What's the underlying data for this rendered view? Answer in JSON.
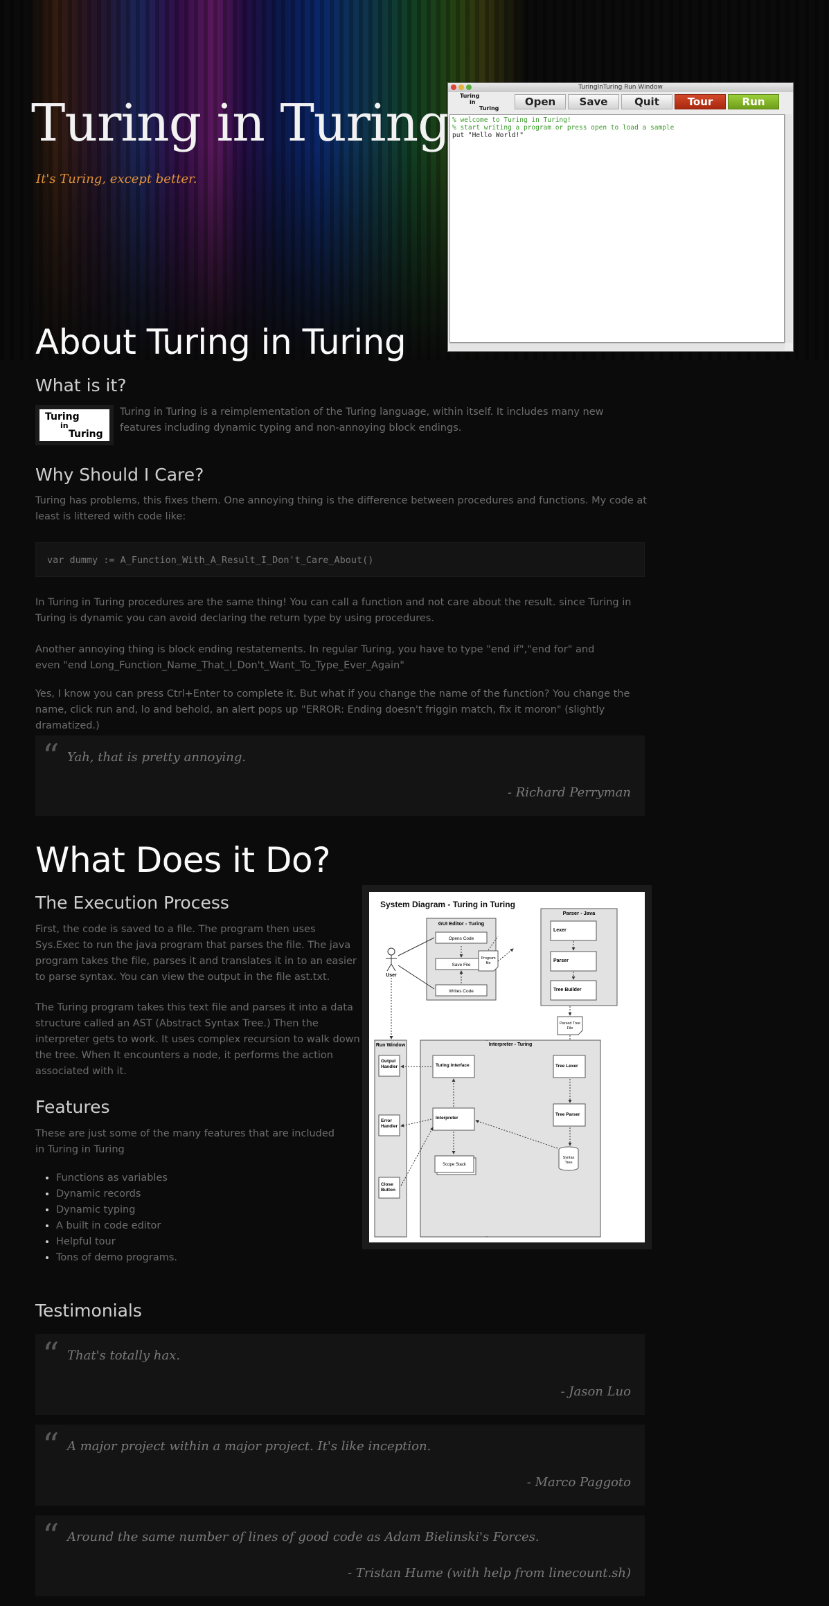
{
  "header": {
    "title": "Turing in Turing",
    "tagline": "It's Turing, except better."
  },
  "run_window": {
    "title": "TuringInTuring Run Window",
    "logo_line1": "Turing",
    "logo_line2": "in",
    "logo_line3": "Turing",
    "buttons": {
      "open": "Open",
      "save": "Save",
      "quit": "Quit",
      "tour": "Tour",
      "run": "Run"
    },
    "code_lines": [
      "% welcome to Turing in Turing!",
      "% start writing a program or press open to load a sample",
      "put \"Hello World!\""
    ],
    "colors": {
      "tour": "#c0381c",
      "run": "#86b82a",
      "comment": "#3a9a2a"
    }
  },
  "about": {
    "heading": "About Turing in Turing",
    "what_heading": "What is it?",
    "logo_line1": "Turing",
    "logo_line2": "in",
    "logo_line3": "Turing",
    "what_text": "Turing in Turing is a reimplementation of the Turing language, within itself. It includes many new features including dynamic typing and non-annoying block endings.",
    "why_heading": "Why Should I Care?",
    "why_p1": "Turing has problems, this fixes them. One annoying thing is the difference between procedures and functions. My code at least is littered with code like:",
    "code": "var dummy := A_Function_With_A_Result_I_Don't_Care_About()",
    "why_p2": "In Turing in Turing procedures are the same thing! You can call a function and not care about the result. since Turing in Turing is dynamic you can avoid declaring the return type by using procedures.",
    "why_p3": "Another annoying thing is block ending restatements. In regular Turing, you have to type \"end if\",\"end for\" and even \"end Long_Function_Name_That_I_Don't_Want_To_Type_Ever_Again\"",
    "why_p4": "Yes, I know you can press Ctrl+Enter to complete it. But what if you change the name of the function? You change the name, click run and, lo and behold, an alert pops up \"ERROR: Ending doesn't friggin match, fix it moron\" (slightly dramatized.)",
    "quote": {
      "mark": "“",
      "text": "Yah, that is pretty annoying.",
      "by": "- Richard Perryman"
    }
  },
  "does": {
    "heading": "What Does it Do?",
    "exec_heading": "The Execution Process",
    "exec_p1": "First, the code is saved to a file. The program then uses Sys.Exec to run the java program that parses the file. The java program takes the file, parses it and translates it in to an easier to parse syntax. You can view the output in the file ast.txt.",
    "exec_p2": "The Turing program takes this text file and parses it into a data structure called an AST (Abstract Syntax Tree.) Then the interpreter gets to work. It uses complex recursion to walk down the tree. When It encounters a node, it performs the action associated with it.",
    "features_heading": "Features",
    "features_intro": "These are just some of the many features that are included in Turing in Turing",
    "features": [
      "Functions as variables",
      "Dynamic records",
      "Dynamic typing",
      "A built in code editor",
      "Helpful tour",
      "Tons of demo programs."
    ]
  },
  "diagram": {
    "title": "System Diagram - Turing in Turing",
    "gui_title": "GUI Editor - Turing",
    "parser_title": "Parser - Java",
    "user": "User",
    "opens_code": "Opens Code",
    "save_file": "Save File",
    "writes_code": "Writes Code",
    "program_file_1": "Program",
    "program_file_2": "file",
    "lexer": "Lexer",
    "parser": "Parser",
    "tree_builder": "Tree Builder",
    "parsed_tree_1": "Parsed Tree",
    "parsed_tree_2": "File",
    "run_window": "Run Window",
    "interp_title": "Interpreter - Turing",
    "output_1": "Output",
    "output_2": "Handler",
    "error_1": "Error",
    "error_2": "Handler",
    "close_1": "Close",
    "close_2": "Button",
    "turing_interface": "Turing Interface",
    "interpreter": "Interpreter",
    "scope_stack": "Scope Stack",
    "tree_lexer": "Tree Lexer",
    "tree_parser": "Tree Parser",
    "syntax_1": "Syntax",
    "syntax_2": "Tree"
  },
  "testimonials": {
    "heading": "Testimonials",
    "items": [
      {
        "mark": "“",
        "text": "That's totally hax.",
        "by": "- Jason Luo"
      },
      {
        "mark": "“",
        "text": "A major project within a major project. It's like inception.",
        "by": "- Marco Paggoto"
      },
      {
        "mark": "“",
        "text": "Around the same number of lines of good code as Adam Bielinski's Forces.",
        "by": "- Tristan Hume (with help from linecount.sh)"
      }
    ]
  }
}
